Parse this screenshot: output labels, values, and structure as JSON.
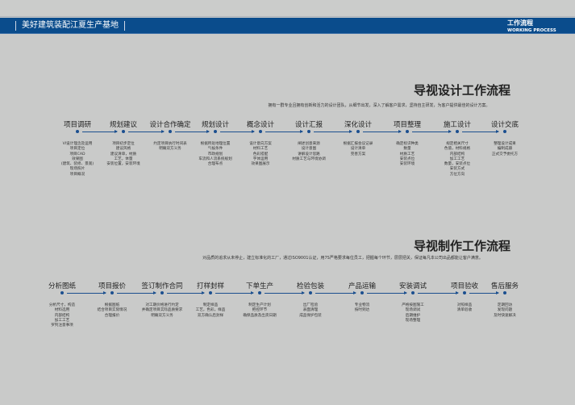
{
  "header": {
    "brand": "美好建筑装配江夏生产基地",
    "section_cn": "工作流程",
    "section_en": "WORKING PROCESS"
  },
  "design": {
    "title": "导视设计工作流程",
    "subtitle": "拥有一群专业且拥有创新和活力的设计团队，从细节出发，深入了解客户需求，坚持自主研发，为客户提供最佳的设计方案。",
    "steps": [
      {
        "label": "项目调研",
        "desc": [
          "VI设计理念及运用",
          "项目定位",
          "项目CAD",
          "效果图",
          "(建筑、装修、景观)",
          "现场照片",
          "项目概况"
        ]
      },
      {
        "label": "规划建议",
        "desc": [
          "项目初步定位",
          "建议风格",
          "建议清单，材质",
          "工艺，体量",
          "安装位置，安装环境"
        ]
      },
      {
        "label": "设计合作确定",
        "desc": [
          "约定项目执行时间表",
          "明确双方义务"
        ]
      },
      {
        "label": "规划设计",
        "desc": [
          "根据所处地理位置",
          "气候条件",
          "市政规划",
          "车流和人流系统规划",
          "合理布点"
        ]
      },
      {
        "label": "概念设计",
        "desc": [
          "设计意向方案",
          "材料工艺",
          "色彩搭配",
          "字体运用",
          "效果图展示"
        ]
      },
      {
        "label": "设计汇报",
        "desc": [
          "阐述创意来源",
          "设计意图",
          "讲解设计思路",
          "材质工艺与环境协调"
        ]
      },
      {
        "label": "深化设计",
        "desc": [
          "根据汇报会议记录",
          "设计清单",
          "完善方案"
        ]
      },
      {
        "label": "项目整理",
        "desc": [
          "确定标识种类",
          "数量",
          "材质工艺",
          "安装点位",
          "安装环境"
        ]
      },
      {
        "label": "施工设计",
        "desc": [
          "规定相关尺寸",
          "色值，材料规格",
          "内部结构",
          "加工工艺",
          "数量，安装点位",
          "安装方式",
          "方位方向"
        ]
      },
      {
        "label": "设计交底",
        "desc": [
          "整理设计成果",
          "编制成册",
          "正式交予委托方"
        ]
      }
    ]
  },
  "production": {
    "title": "导视制作工作流程",
    "subtitle": "对品质的追求从未停止，建立标准化的工厂，通过ISO9001认证，用7S严格要求每位员工，把握每个环节，层层把关，保证每凡本公司出品都能让客户满意。",
    "steps": [
      {
        "label": "分析图纸",
        "desc": [
          "分析尺寸，构造",
          "材料选用",
          "内部结构",
          "加工工艺",
          "罗列注意事项"
        ]
      },
      {
        "label": "项目报价",
        "desc": [
          "根据图纸",
          "结合项目实际情况",
          "合理报价"
        ]
      },
      {
        "label": "签订制作合同",
        "desc": [
          "对工期价格进行约定",
          "并确定项目实际品质要求",
          "明确双方义务"
        ]
      },
      {
        "label": "打样封样",
        "desc": [
          "制定样品",
          "工艺，色彩，样品",
          "双方确认后封样"
        ]
      },
      {
        "label": "下单生产",
        "desc": [
          "制定生产计划",
          "把控环节",
          "确保品质及出货日期"
        ]
      },
      {
        "label": "检验包装",
        "desc": [
          "出厂检验",
          "表面清理",
          "成品保护包装"
        ]
      },
      {
        "label": "产品运输",
        "desc": [
          "专业物流",
          "按时到达"
        ]
      },
      {
        "label": "安装调试",
        "desc": [
          "严格按图施工",
          "现场调试",
          "后期维护",
          "现场整理"
        ]
      },
      {
        "label": "项目验收",
        "desc": [
          "对照样品",
          "清单验收"
        ]
      },
      {
        "label": "售后服务",
        "desc": [
          "定期回访",
          "发现问题",
          "及时快速解决"
        ]
      }
    ]
  }
}
